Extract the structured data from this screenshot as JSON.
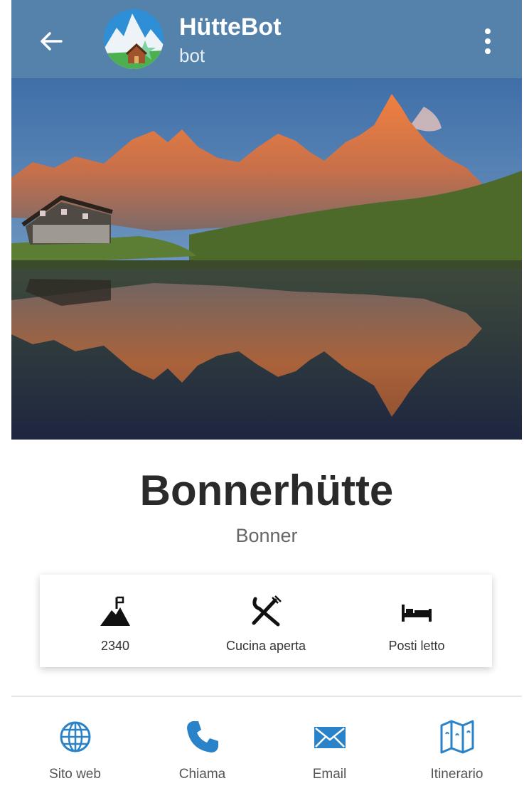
{
  "header": {
    "title": "HütteBot",
    "subtitle": "bot",
    "back_icon": "arrow-left-icon",
    "menu_icon": "more-vertical-icon",
    "color": "#5582ab"
  },
  "hut": {
    "name": "Bonnerhütte",
    "subname": "Bonner"
  },
  "info": [
    {
      "icon": "summit-flag-icon",
      "label": "2340"
    },
    {
      "icon": "fork-knife-icon",
      "label": "Cucina aperta"
    },
    {
      "icon": "bed-icon",
      "label": "Posti letto"
    }
  ],
  "actions": [
    {
      "icon": "globe-icon",
      "label": "Sito web"
    },
    {
      "icon": "phone-icon",
      "label": "Chiama"
    },
    {
      "icon": "email-icon",
      "label": "Email"
    },
    {
      "icon": "map-icon",
      "label": "Itinerario"
    }
  ],
  "accent": "#2a82c8"
}
